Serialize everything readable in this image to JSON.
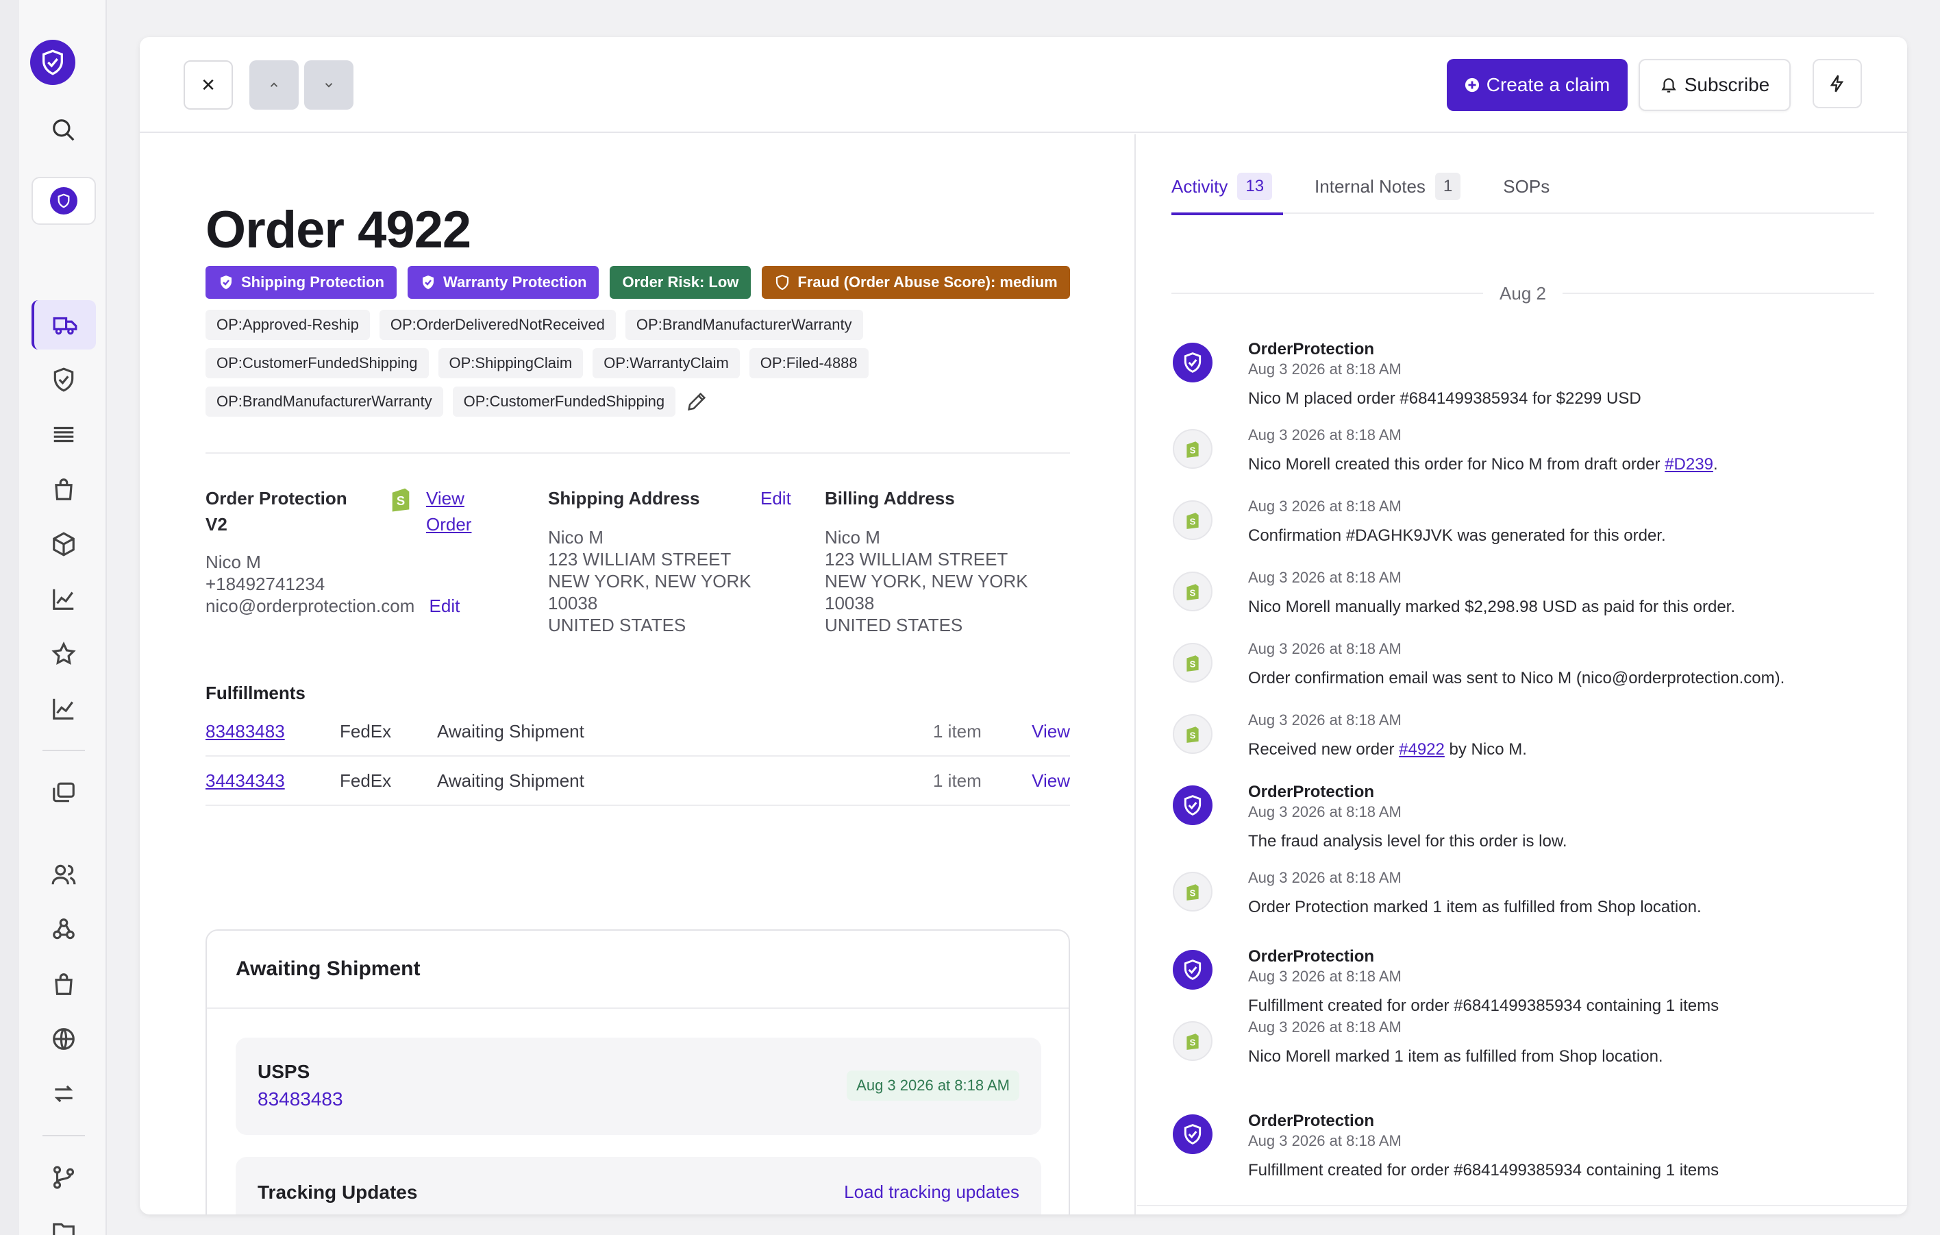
{
  "toolbar": {
    "create_claim": "Create a claim",
    "subscribe": "Subscribe"
  },
  "order": {
    "title": "Order 4922",
    "badges": {
      "shipping": "Shipping Protection",
      "warranty": "Warranty Protection",
      "risk": "Order Risk: Low",
      "fraud": "Fraud (Order Abuse Score): medium"
    },
    "tags": [
      "OP:Approved-Reship",
      "OP:OrderDeliveredNotReceived",
      "OP:BrandManufacturerWarranty",
      "OP:CustomerFundedShipping",
      "OP:ShippingClaim",
      "OP:WarrantyClaim",
      "OP:Filed-4888",
      "OP:BrandManufacturerWarranty",
      "OP:CustomerFundedShipping"
    ]
  },
  "customer": {
    "store_line1": "Order Protection",
    "store_line2": "V2",
    "view_line1": "View",
    "view_line2": "Order",
    "name": "Nico M",
    "phone": "+18492741234",
    "email": "nico@orderprotection.com",
    "edit": "Edit"
  },
  "shipping": {
    "heading": "Shipping Address",
    "edit": "Edit",
    "lines": [
      "Nico M",
      "123 WILLIAM STREET",
      "NEW YORK, NEW YORK",
      "10038",
      "UNITED STATES"
    ]
  },
  "billing": {
    "heading": "Billing Address",
    "lines": [
      "Nico M",
      "123 WILLIAM STREET",
      "NEW YORK, NEW YORK",
      "10038",
      "UNITED STATES"
    ]
  },
  "fulfillments": {
    "title": "Fulfillments",
    "rows": [
      {
        "id": "83483483",
        "carrier": "FedEx",
        "status": "Awaiting Shipment",
        "items": "1 item",
        "action": "View"
      },
      {
        "id": "34434343",
        "carrier": "FedEx",
        "status": "Awaiting Shipment",
        "items": "1 item",
        "action": "View"
      }
    ]
  },
  "shipment_card": {
    "title": "Awaiting Shipment",
    "carrier": "USPS",
    "tracking_number": "83483483",
    "date": "Aug 3 2026 at 8:18 AM",
    "tracking_title": "Tracking Updates",
    "tracking_link": "Load tracking updates"
  },
  "tabs": [
    {
      "label": "Activity",
      "count": "13"
    },
    {
      "label": "Internal Notes",
      "count": "1"
    },
    {
      "label": "SOPs",
      "count": ""
    }
  ],
  "activity": {
    "day": "Aug 2",
    "items": [
      {
        "who": "OrderProtection",
        "when": "Aug 3 2026 at 8:18 AM",
        "msg": "Nico M placed order #6841499385934 for $2299 USD"
      },
      {
        "who": "",
        "when": "Aug 3 2026 at 8:18 AM",
        "msg_pre": "Nico Morell created this order for Nico M from draft order ",
        "msg_link": "#D239",
        "msg_post": "."
      },
      {
        "who": "",
        "when": "Aug 3 2026 at 8:18 AM",
        "msg": "Confirmation #DAGHK9JVK was generated for this order."
      },
      {
        "who": "",
        "when": "Aug 3 2026 at 8:18 AM",
        "msg": "Nico Morell manually marked $2,298.98 USD as paid for this order."
      },
      {
        "who": "",
        "when": "Aug 3 2026 at 8:18 AM",
        "msg": "Order confirmation email was sent to Nico M (nico@orderprotection.com)."
      },
      {
        "who": "",
        "when": "Aug 3 2026 at 8:18 AM",
        "msg_pre": "Received new order ",
        "msg_link": "#4922",
        "msg_post": " by Nico M."
      },
      {
        "who": "OrderProtection",
        "when": "Aug 3 2026 at 8:18 AM",
        "msg": "The fraud analysis level for this order is low."
      },
      {
        "who": "",
        "when": "Aug 3 2026 at 8:18 AM",
        "msg": "Order Protection marked 1 item as fulfilled from Shop location."
      },
      {
        "who": "OrderProtection",
        "when": "Aug 3 2026 at 8:18 AM",
        "msg": "Fulfillment created for order #6841499385934 containing 1 items"
      },
      {
        "who": "",
        "when": "Aug 3 2026 at 8:18 AM",
        "msg": "Nico Morell marked 1 item as fulfilled from Shop location."
      },
      {
        "who": "OrderProtection",
        "when": "Aug 3 2026 at 8:18 AM",
        "msg": "Fulfillment created for order #6841499385934 containing 1 items"
      }
    ]
  },
  "colors": {
    "brand": "#4b1fc9",
    "badge_purple": "#6d3fe0",
    "badge_green": "#2f7a51",
    "badge_orange": "#a85a10"
  }
}
